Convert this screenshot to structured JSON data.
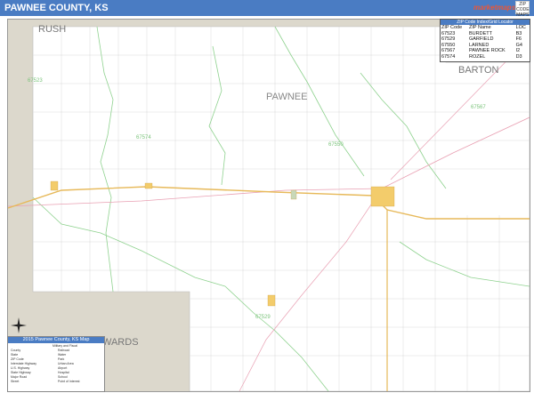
{
  "title": "PAWNEE COUNTY, KS",
  "logo": {
    "text": "marketmaps",
    "badge": "ZIP CODE MAPS"
  },
  "county_labels": {
    "rush": "RUSH",
    "barton": "BARTON",
    "pawnee": "PAWNEE",
    "edwards": "WARDS"
  },
  "zip_labels": [
    "67523",
    "67574",
    "67550",
    "67567",
    "67529"
  ],
  "zip_table": {
    "header": "ZIP Code Index/Grid Locator",
    "columns": [
      "ZIP Code",
      "ZIP Name",
      "LOC"
    ],
    "rows": [
      [
        "67523",
        "BURDETT",
        "B3"
      ],
      [
        "67529",
        "GARFIELD",
        "F6"
      ],
      [
        "67550",
        "LARNED",
        "G4"
      ],
      [
        "67567",
        "PAWNEE ROCK",
        "I2"
      ],
      [
        "67574",
        "ROZEL",
        "D3"
      ]
    ]
  },
  "legend": {
    "title": "2015 Pawnee County, KS Map",
    "subtitle": "Military and Fiscal",
    "items": [
      "County",
      "State",
      "ZIP Code",
      "Interstate Highway",
      "U.S. Highway",
      "State Highway",
      "Major Road",
      "Street",
      "Railroad",
      "Water",
      "Park",
      "Urban Area",
      "Airport",
      "Hospital",
      "School",
      "Point of Interest"
    ]
  },
  "colors": {
    "title_bar": "#4a7cc3",
    "neighbor_county": "#dcd8cc",
    "zip_boundary": "#8fd28f",
    "highway": "#e7b95a",
    "railroad": "#e9a0b3",
    "grid_road": "#d9d9d9",
    "urban": "#f3cc6b"
  }
}
